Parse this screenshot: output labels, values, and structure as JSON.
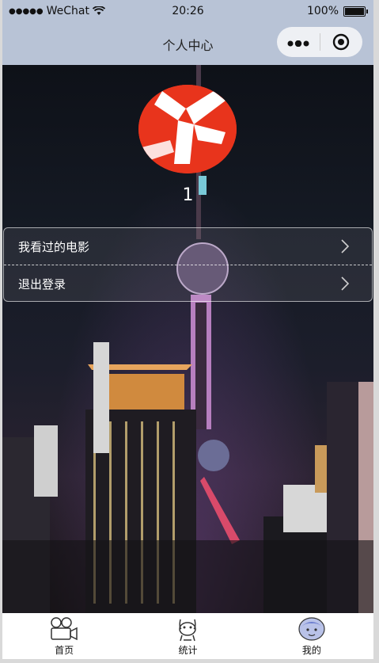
{
  "status_bar": {
    "carrier": "WeChat",
    "time": "20:26",
    "battery": "100%"
  },
  "nav": {
    "title": "个人中心"
  },
  "profile": {
    "name": "1"
  },
  "menu": [
    {
      "label": "我看过的电影"
    },
    {
      "label": "退出登录"
    }
  ],
  "tabs": [
    {
      "label": "首页",
      "icon": "camera-icon"
    },
    {
      "label": "统计",
      "icon": "cartoon-character-icon"
    },
    {
      "label": "我的",
      "icon": "avatar-face-icon"
    }
  ]
}
